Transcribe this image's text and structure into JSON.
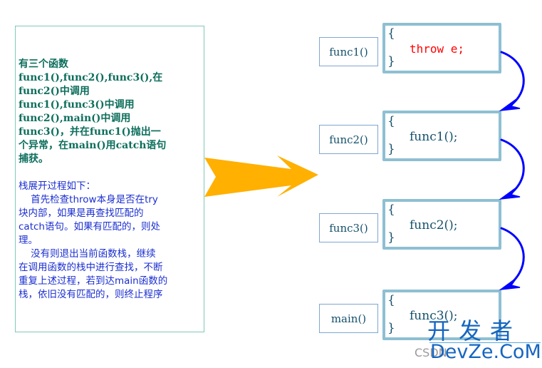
{
  "description": {
    "intro": "有三个函数\nfunc1(),func2(),func3(),在\nfunc2()中调用\nfunc1(),func3()中调用\nfunc2(),main()中调用\nfunc3()，并在func1()抛出一\n个异常，在main()用catch语句\n捕获。",
    "process": "栈展开过程如下：\n    首先检查throw本身是否在try\n块内部，如果是再查找匹配的\ncatch语句。如果有匹配的，则处\n理。\n    没有则退出当前函数栈，继续\n在调用函数的栈中进行查找，不断\n重复上述过程，若到达main函数的\n栈，依旧没有匹配的，则终止程序"
  },
  "colors": {
    "intro_text": "#0d6e5c",
    "process_text": "#1b2fd0",
    "big_arrow": "#ffb000",
    "curve_arrow": "#0000ff",
    "box_border": "#8ebfd2",
    "throw_text": "#ff0000",
    "code_text": "#13506b"
  },
  "stack": [
    {
      "name": "func1()",
      "open": "{",
      "statement": "throw e;",
      "close": "}",
      "is_throw": true
    },
    {
      "name": "func2()",
      "open": "{",
      "statement": "func1();",
      "close": "}",
      "is_throw": false
    },
    {
      "name": "func3()",
      "open": "{",
      "statement": "func2();",
      "close": "}",
      "is_throw": false
    },
    {
      "name": "main()",
      "open": "{",
      "statement": "func3();",
      "close": "}",
      "is_throw": false
    }
  ],
  "watermark": {
    "cn": "开发者",
    "en": "DevZe.CoM",
    "csdn": "CSDN"
  }
}
